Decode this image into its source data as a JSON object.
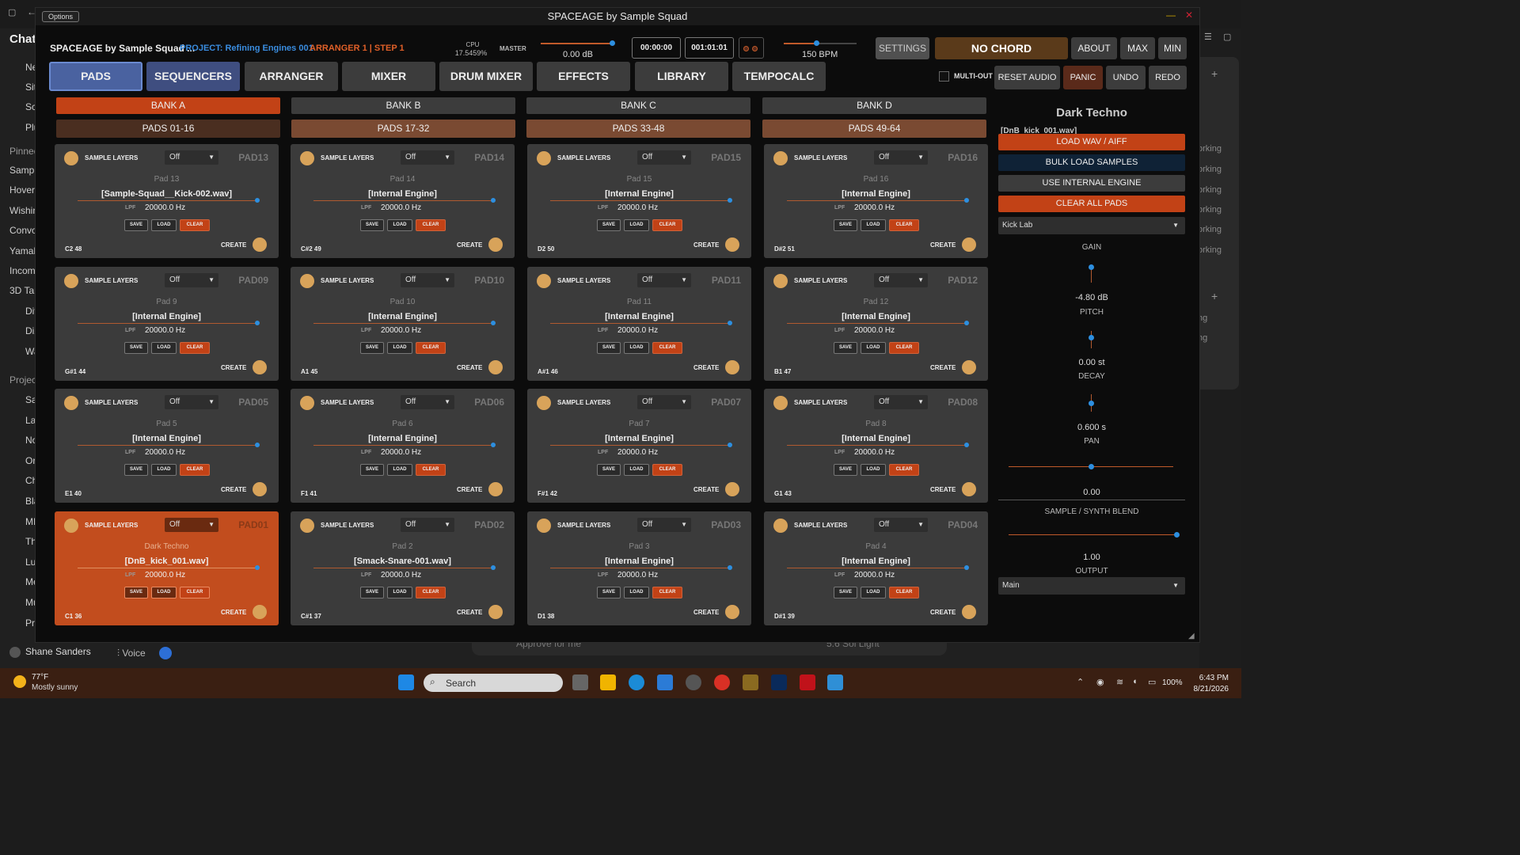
{
  "background_app": {
    "sidebar_title": "Chat",
    "sidebar_items": [
      "Ne",
      "Sit",
      "Sc",
      "Plu"
    ],
    "pinned_label": "Pinned",
    "pinned_items": [
      "Sample",
      "Hover",
      "Wishin",
      "Convo",
      "Yamah",
      "Incom",
      "3D Tar",
      "Div",
      "Diz",
      "Wa"
    ],
    "projects_label": "Projec",
    "project_items": [
      "Sa",
      "Las",
      "No",
      "Or",
      "Ch",
      "Bla",
      "MI",
      "Th",
      "Lu",
      "Me",
      "Mu",
      "Pro"
    ],
    "right_items": [
      "orking",
      "orking",
      "orking",
      "orking",
      "orking",
      "orking",
      "ng",
      "ng"
    ],
    "user_name": "Shane Sanders",
    "voice_label": "Voice",
    "compose_placeholder": "Approve for me",
    "model_label": "5.6 Sol Light"
  },
  "window": {
    "title": "SPACEAGE by Sample Squad",
    "options_label": "Options",
    "min_glyph": "—",
    "close_glyph": "✕"
  },
  "header": {
    "brand": "SPACEAGE by Sample Squad ...",
    "project": "PROJECT: Refining Engines 001",
    "arranger_step": "ARRANGER 1  |  STEP 1",
    "cpu_label": "CPU",
    "cpu_value": "17.5459%",
    "master_label": "MASTER",
    "master_db": "0.00 dB",
    "master_level": 0.98,
    "time_elapsed": "00:00:00",
    "time_position": "001:01:01",
    "bpm": "150 BPM",
    "bpm_level": 0.45,
    "settings": "SETTINGS",
    "chord": "NO CHORD",
    "about": "ABOUT",
    "max": "MAX",
    "min": "MIN"
  },
  "tabs": [
    "PADS",
    "SEQUENCERS",
    "ARRANGER",
    "MIXER",
    "DRUM MIXER",
    "EFFECTS",
    "LIBRARY",
    "TEMPOCALC"
  ],
  "toolbar": {
    "multi_out": "MULTI-OUT",
    "reset_audio": "RESET AUDIO",
    "panic": "PANIC",
    "undo": "UNDO",
    "redo": "REDO"
  },
  "banks": [
    "BANK A",
    "BANK B",
    "BANK C",
    "BANK D"
  ],
  "pad_ranges": [
    "PADS 01-16",
    "PADS 17-32",
    "PADS 33-48",
    "PADS 49-64"
  ],
  "pad_labels": {
    "sample_layers": "SAMPLE LAYERS",
    "select_value": "Off",
    "lpf": "LPF",
    "save": "SAVE",
    "load": "LOAD",
    "clear": "CLEAR",
    "create": "CREATE"
  },
  "pads": [
    {
      "id": "PAD13",
      "name": "Pad 13",
      "sample": "[Sample-Squad__Kick-002.wav]",
      "lpf": "20000.0 Hz",
      "note": "C2  48"
    },
    {
      "id": "PAD14",
      "name": "Pad 14",
      "sample": "[Internal Engine]",
      "lpf": "20000.0 Hz",
      "note": "C#2  49"
    },
    {
      "id": "PAD15",
      "name": "Pad 15",
      "sample": "[Internal Engine]",
      "lpf": "20000.0 Hz",
      "note": "D2  50"
    },
    {
      "id": "PAD16",
      "name": "Pad 16",
      "sample": "[Internal Engine]",
      "lpf": "20000.0 Hz",
      "note": "D#2  51"
    },
    {
      "id": "PAD09",
      "name": "Pad 9",
      "sample": "[Internal Engine]",
      "lpf": "20000.0 Hz",
      "note": "G#1  44"
    },
    {
      "id": "PAD10",
      "name": "Pad 10",
      "sample": "[Internal Engine]",
      "lpf": "20000.0 Hz",
      "note": "A1  45"
    },
    {
      "id": "PAD11",
      "name": "Pad 11",
      "sample": "[Internal Engine]",
      "lpf": "20000.0 Hz",
      "note": "A#1  46"
    },
    {
      "id": "PAD12",
      "name": "Pad 12",
      "sample": "[Internal Engine]",
      "lpf": "20000.0 Hz",
      "note": "B1  47"
    },
    {
      "id": "PAD05",
      "name": "Pad 5",
      "sample": "[Internal Engine]",
      "lpf": "20000.0 Hz",
      "note": "E1  40"
    },
    {
      "id": "PAD06",
      "name": "Pad 6",
      "sample": "[Internal Engine]",
      "lpf": "20000.0 Hz",
      "note": "F1  41"
    },
    {
      "id": "PAD07",
      "name": "Pad 7",
      "sample": "[Internal Engine]",
      "lpf": "20000.0 Hz",
      "note": "F#1  42"
    },
    {
      "id": "PAD08",
      "name": "Pad 8",
      "sample": "[Internal Engine]",
      "lpf": "20000.0 Hz",
      "note": "G1  43"
    },
    {
      "id": "PAD01",
      "name": "Dark Techno",
      "sample": "[DnB_kick_001.wav]",
      "lpf": "20000.0 Hz",
      "note": "C1  36",
      "active": true
    },
    {
      "id": "PAD02",
      "name": "Pad 2",
      "sample": "[Smack-Snare-001.wav]",
      "lpf": "20000.0 Hz",
      "note": "C#1  37"
    },
    {
      "id": "PAD03",
      "name": "Pad 3",
      "sample": "[Internal Engine]",
      "lpf": "20000.0 Hz",
      "note": "D1  38"
    },
    {
      "id": "PAD04",
      "name": "Pad 4",
      "sample": "[Internal Engine]",
      "lpf": "20000.0 Hz",
      "note": "D#1  39"
    }
  ],
  "right_panel": {
    "title": "Dark Techno",
    "file": "[DnB_kick_001.wav]",
    "load_wav": "LOAD WAV / AIFF",
    "bulk_load": "BULK LOAD SAMPLES",
    "use_internal": "USE INTERNAL ENGINE",
    "clear_all": "CLEAR ALL PADS",
    "engine_select": "Kick Lab",
    "gain_label": "GAIN",
    "gain_value": "-4.80 dB",
    "pitch_label": "PITCH",
    "pitch_value": "0.00 st",
    "decay_label": "DECAY",
    "decay_value": "0.600 s",
    "pan_label": "PAN",
    "pan_value": "0.00",
    "blend_label": "SAMPLE / SYNTH BLEND",
    "blend_value": "1.00",
    "output_label": "OUTPUT",
    "output_select": "Main"
  },
  "taskbar": {
    "weather_temp": "77°F",
    "weather_desc": "Mostly sunny",
    "search": "Search",
    "battery": "100%",
    "time": "6:43 PM",
    "date": "8/21/2026"
  },
  "colors": {
    "accent_orange": "#c24216",
    "accent_blue": "#2d8fe0",
    "active_tab": "#4a62a0",
    "pad_bg": "#3b3b3b"
  }
}
